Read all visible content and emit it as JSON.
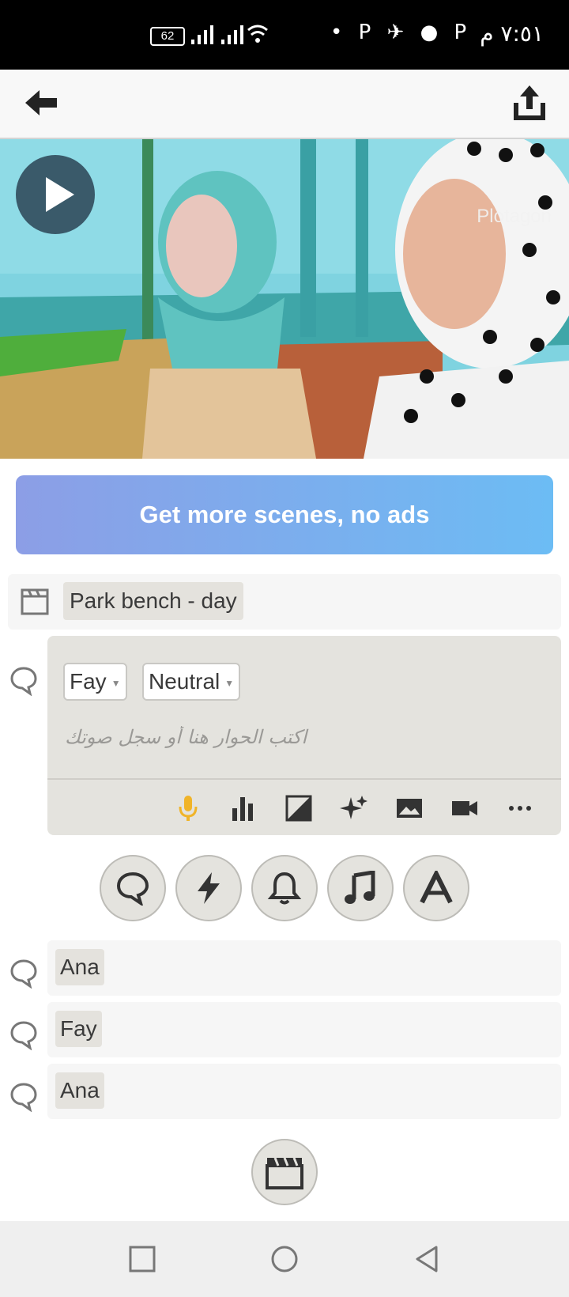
{
  "status_bar": {
    "time": "٧:٥١ م",
    "battery": "62",
    "app_icons": "• P ✈ ● P"
  },
  "scene": {
    "watermark": "Plotagon"
  },
  "promo": {
    "label": "Get more scenes, no ads"
  },
  "location": {
    "label": "Park bench - day"
  },
  "editor": {
    "character": "Fay",
    "emotion": "Neutral",
    "placeholder": "اكتب الحوار هنا أو سجل صوتك",
    "tools": [
      "mic-icon",
      "audio-bars-icon",
      "image-contrast-icon",
      "effects-sparkle-icon",
      "landscape-icon",
      "video-camera-icon",
      "more-icon"
    ]
  },
  "actions": [
    "dialogue-icon",
    "lightning-icon",
    "bell-icon",
    "music-icon",
    "text-icon"
  ],
  "lines": [
    {
      "character": "Ana"
    },
    {
      "character": "Fay"
    },
    {
      "character": "Ana"
    }
  ],
  "colors": {
    "accent_mic": "#f0b429",
    "promo_start": "#8c9ee6",
    "promo_end": "#6cbcf4",
    "chip": "#e4e2dd"
  }
}
